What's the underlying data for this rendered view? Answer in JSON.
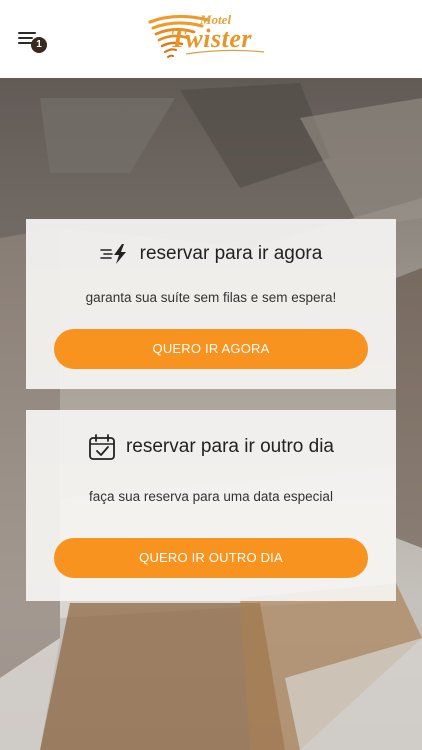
{
  "header": {
    "menu_badge": "1",
    "logo": {
      "top": "Motel",
      "main": "Twister"
    }
  },
  "cards": [
    {
      "title": "reservar para ir agora",
      "subtitle": "garanta sua suíte sem filas e sem espera!",
      "button": "QUERO IR AGORA",
      "icon": "speed-bolt-icon"
    },
    {
      "title": "reservar para ir outro dia",
      "subtitle": "faça sua reserva para uma data especial",
      "button": "QUERO IR OUTRO DIA",
      "icon": "calendar-check-icon"
    }
  ],
  "colors": {
    "accent": "#f7931e",
    "logo": "#e8962a",
    "badge": "#3a2a1e"
  }
}
